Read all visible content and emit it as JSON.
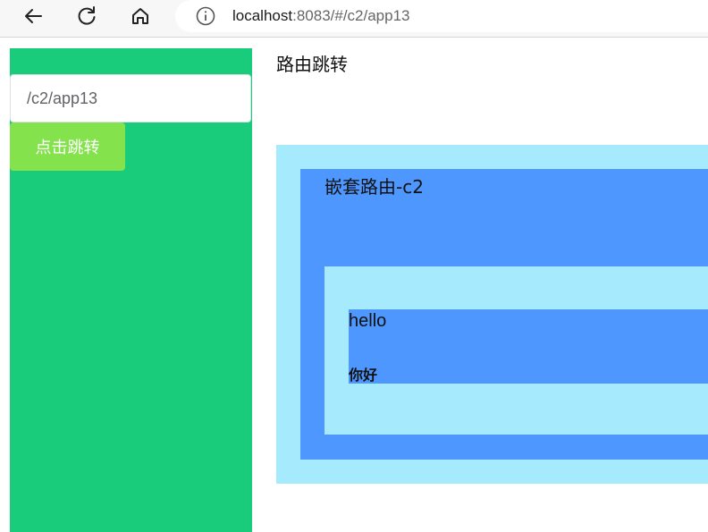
{
  "browser": {
    "url_host": "localhost",
    "url_rest": ":8083/#/c2/app13",
    "back_icon": "back-arrow-icon",
    "reload_icon": "reload-icon",
    "home_icon": "home-icon",
    "info_icon": "info-icon"
  },
  "sidebar": {
    "route_input_value": "/c2/app13",
    "jump_button_label": "点击跳转"
  },
  "main": {
    "title": "路由跳转",
    "nested_title": "嵌套路由-c2",
    "hello_text": "hello",
    "nihao_text": "你好"
  },
  "colors": {
    "sidebar_green": "#19cc7b",
    "button_green": "#84e34c",
    "light_blue": "#a6eafd",
    "blue": "#4e97fe"
  }
}
